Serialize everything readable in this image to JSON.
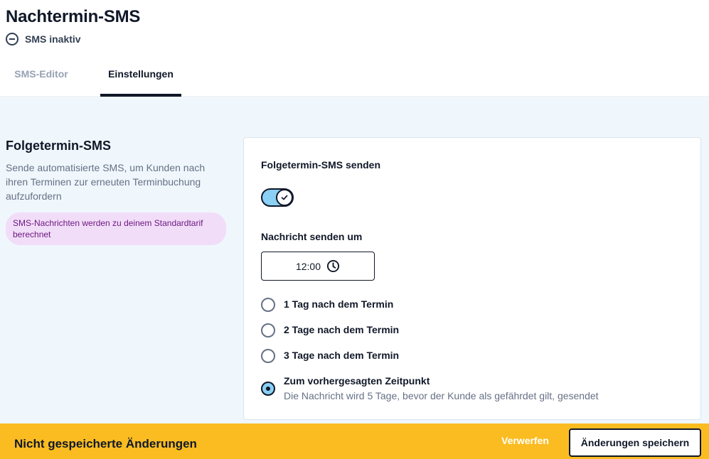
{
  "header": {
    "title": "Nachtermin-SMS",
    "status": "SMS inaktiv",
    "status_icon": "minus-circle-icon"
  },
  "tabs": [
    {
      "label": "SMS-Editor",
      "active": false
    },
    {
      "label": "Einstellungen",
      "active": true
    }
  ],
  "section": {
    "title": "Folgetermin-SMS",
    "description": "Sende automatisierte SMS, um Kunden nach ihren Terminen zur erneuten Terminbuchung aufzufordern",
    "badge": "SMS-Nachrichten werden zu deinem Standardtarif berechnet"
  },
  "settings": {
    "send_label": "Folgetermin-SMS senden",
    "send_enabled": true,
    "time_label": "Nachricht senden um",
    "time_value": "12:00",
    "time_icon": "clock-icon",
    "options": [
      {
        "label": "1 Tag nach dem Termin",
        "selected": false
      },
      {
        "label": "2 Tage nach dem Termin",
        "selected": false
      },
      {
        "label": "3 Tage nach dem Termin",
        "selected": false
      },
      {
        "label": "Zum vorhergesagten Zeitpunkt",
        "description": "Die Nachricht wird 5 Tage, bevor der Kunde als gefährdet gilt, gesendet",
        "selected": true
      }
    ]
  },
  "footer": {
    "message": "Nicht gespeicherte Änderungen",
    "discard_label": "Verwerfen",
    "save_label": "Änderungen speichern"
  },
  "colors": {
    "accent": "#8bd0f5",
    "footer_background": "#fbbc21",
    "content_background": "#eff7fc",
    "badge_background": "#f2ddf9",
    "badge_text": "#6b177f"
  }
}
